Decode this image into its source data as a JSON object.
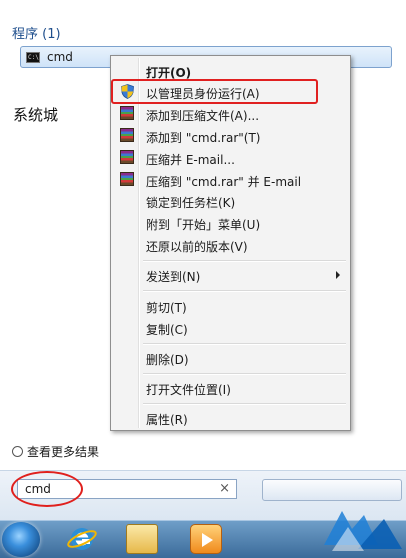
{
  "start_menu": {
    "section_header": "程序 (1)",
    "result_label": "cmd",
    "side_text": "系统城",
    "see_more": "查看更多结果",
    "search_value": "cmd",
    "clear_glyph": "×"
  },
  "context_menu": {
    "items": [
      {
        "label": "打开(O)",
        "icon": "none"
      },
      {
        "label": "以管理员身份运行(A)",
        "icon": "uac-shield-icon"
      },
      {
        "label": "添加到压缩文件(A)...",
        "icon": "winrar-icon"
      },
      {
        "label": "添加到 \"cmd.rar\"(T)",
        "icon": "winrar-icon"
      },
      {
        "label": "压缩并 E-mail...",
        "icon": "winrar-icon"
      },
      {
        "label": "压缩到 \"cmd.rar\" 并 E-mail",
        "icon": "winrar-icon"
      },
      {
        "label": "锁定到任务栏(K)",
        "icon": "none"
      },
      {
        "label": "附到「开始」菜单(U)",
        "icon": "none"
      },
      {
        "label": "还原以前的版本(V)",
        "icon": "none"
      },
      {
        "label": "发送到(N)",
        "icon": "none"
      },
      {
        "label": "剪切(T)",
        "icon": "none"
      },
      {
        "label": "复制(C)",
        "icon": "none"
      },
      {
        "label": "删除(D)",
        "icon": "none"
      },
      {
        "label": "打开文件位置(I)",
        "icon": "none"
      },
      {
        "label": "属性(R)",
        "icon": "none"
      }
    ]
  },
  "colors": {
    "accent_red": "#e0201d",
    "header_blue": "#1e4e8c"
  }
}
